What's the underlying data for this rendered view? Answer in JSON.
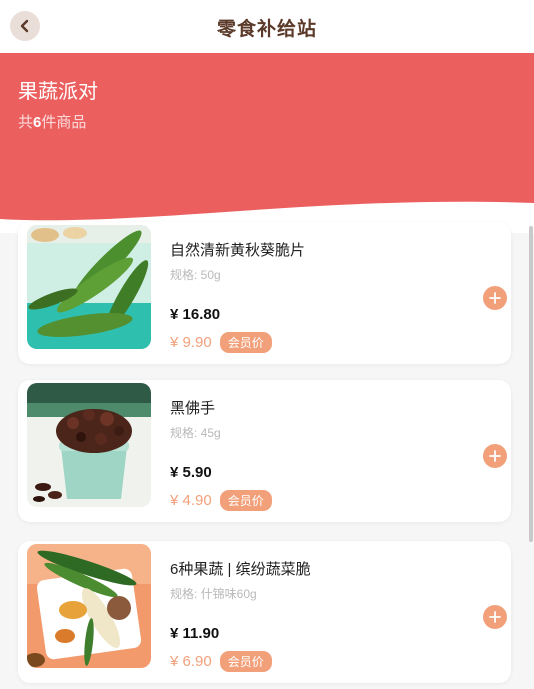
{
  "header": {
    "title": "零食补给站",
    "back_icon": "chevron-left-icon"
  },
  "banner": {
    "title": "果蔬派对",
    "count_prefix": "共",
    "count": "6",
    "count_suffix": "件商品",
    "color": "#ec5f5f"
  },
  "products": [
    {
      "name": "自然清新黄秋葵脆片",
      "spec": "规格: 50g",
      "price": "¥ 16.80",
      "member_price": "¥ 9.90",
      "member_label": "会员价"
    },
    {
      "name": "黑佛手",
      "spec": "规格: 45g",
      "price": "¥ 5.90",
      "member_price": "¥ 4.90",
      "member_label": "会员价"
    },
    {
      "name": "6种果蔬 | 缤纷蔬菜脆",
      "spec": "规格: 什锦味60g",
      "price": "¥ 11.90",
      "member_price": "¥ 6.90",
      "member_label": "会员价"
    }
  ],
  "colors": {
    "accent": "#f2a07a",
    "title_brown": "#5b3a2a"
  }
}
